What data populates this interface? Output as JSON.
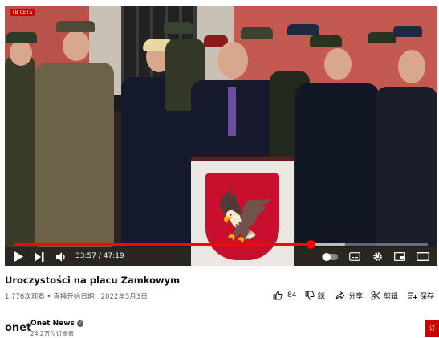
{
  "player": {
    "live_badge": "ТВ СЕТЬ",
    "time_current": "33:57",
    "time_separator": "/",
    "time_total": "47:19",
    "progress": 0.717,
    "buffered": 0.8,
    "progress_color": "#ff0000",
    "controls": {
      "play": "play-icon",
      "next": "next-icon",
      "volume": "volume-icon",
      "autoplay": "autoplay-toggle",
      "subtitles": "subtitles-icon",
      "settings": "gear-icon",
      "miniplayer": "miniplayer-icon",
      "theater": "theater-icon"
    }
  },
  "video": {
    "title": "Uroczystości na placu Zamkowym",
    "meta": "1,776次观看 • 直播开始日期：2022年5月3日"
  },
  "actions": {
    "likes": "84",
    "dislike_label": "踩",
    "share_label": "分享",
    "clip_label": "剪辑",
    "save_label": "保存"
  },
  "channel": {
    "logo_text": "onet",
    "name": "Onet News",
    "subscribers": "24.2万位订阅者",
    "subscribe_label": "订"
  }
}
